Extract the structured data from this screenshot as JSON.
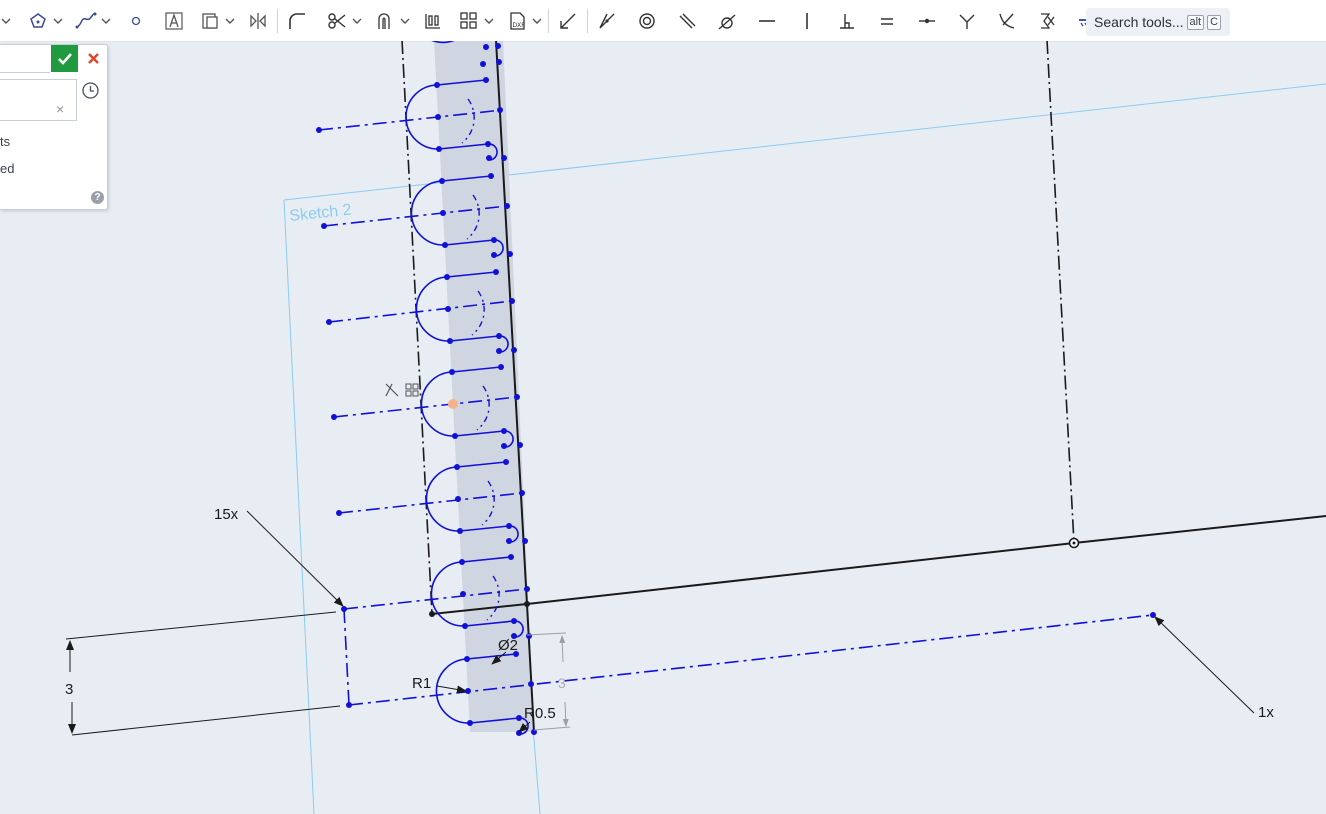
{
  "toolbar": {
    "search_label": "Search tools...",
    "shortcut_alt": "alt",
    "shortcut_key": "C"
  },
  "dialog": {
    "option_1_partial": "ts",
    "option_2_partial": "ed",
    "clear_glyph": "×",
    "help_glyph": "?"
  },
  "sketch": {
    "name": "Sketch 2",
    "label_15x": "15x",
    "label_1x": "1x",
    "dim_3_left": "3",
    "dim_3_inner": "3",
    "dim_d2": "Ø2",
    "dim_r1": "R1",
    "dim_r05": "R0.5"
  },
  "colors": {
    "accept": "#1f9a3f",
    "cancel": "#e0452a",
    "sketch_blue": "#1010d8",
    "plane_blue": "#8ccbf0"
  }
}
